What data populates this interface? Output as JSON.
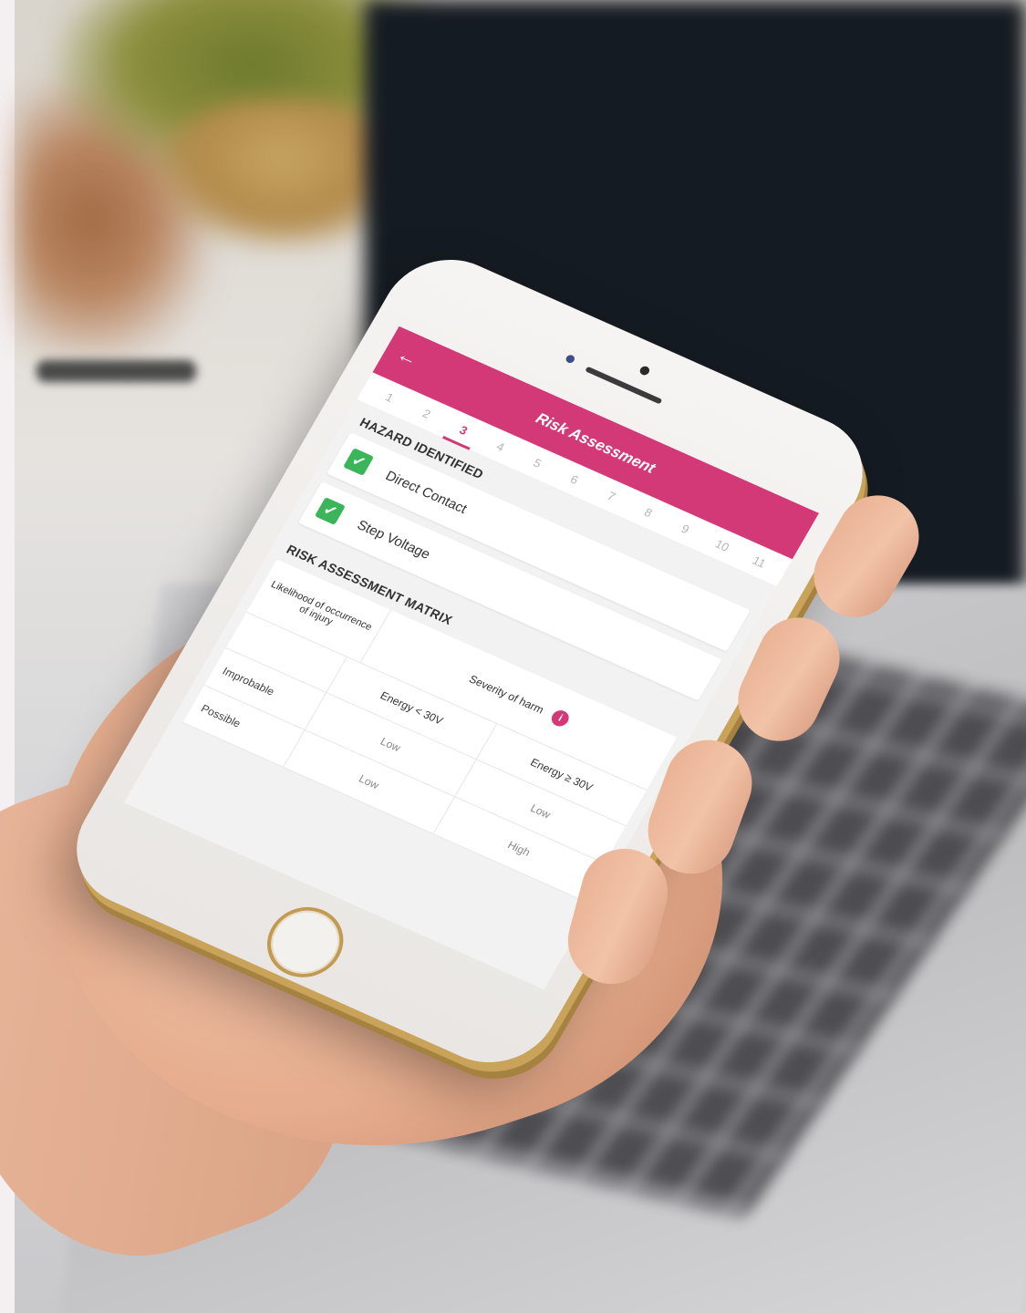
{
  "app": {
    "title": "Risk Assessment",
    "accent_color": "#d33877",
    "back_icon": "arrow-left-icon"
  },
  "steps": {
    "items": [
      "1",
      "2",
      "3",
      "4",
      "5",
      "6",
      "7",
      "8",
      "9",
      "10",
      "11"
    ],
    "active": "3"
  },
  "hazard_section": {
    "title": "HAZARD IDENTIFIED",
    "items": [
      {
        "label": "Direct Contact",
        "checked": true
      },
      {
        "label": "Step Voltage",
        "checked": true
      }
    ],
    "check_color": "#3bb55a"
  },
  "matrix": {
    "title": "RISK ASSESSMENT MATRIX",
    "likelihood_header": "Likelihood of occurrence of injury",
    "severity_header": "Severity of harm",
    "columns": [
      "Energy < 30V",
      "Energy ≥ 30V"
    ],
    "rows": [
      {
        "label": "Improbable",
        "values": [
          "Low",
          "Low"
        ]
      },
      {
        "label": "Possible",
        "values": [
          "Low",
          "High"
        ]
      }
    ]
  }
}
